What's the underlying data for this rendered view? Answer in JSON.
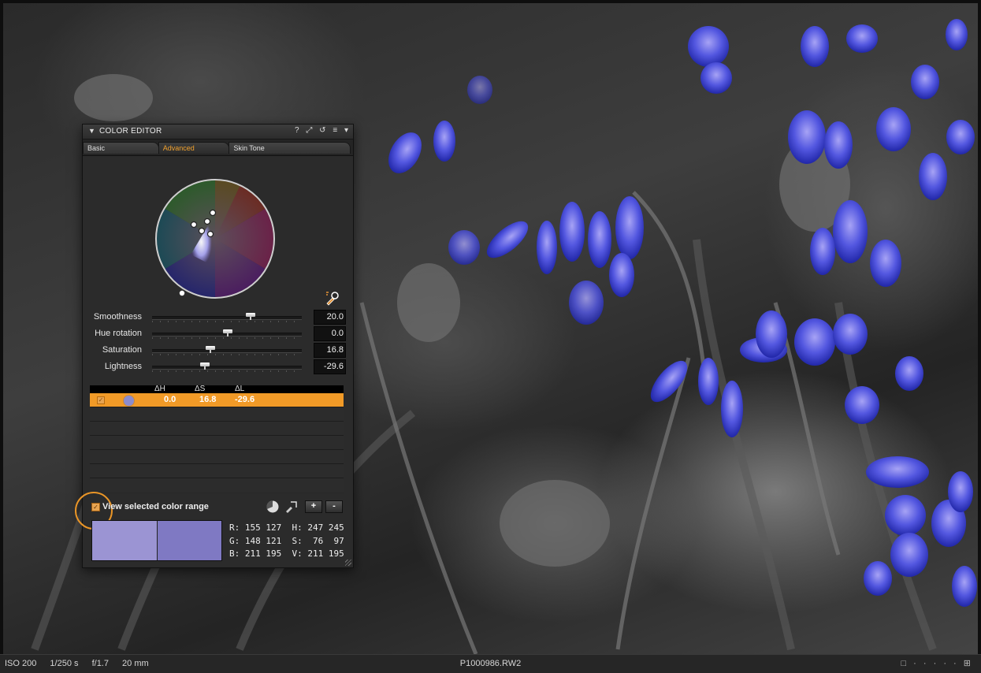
{
  "panel": {
    "title": "COLOR EDITOR",
    "tool_icons": [
      "help-icon",
      "pop-out-icon",
      "reset-icon",
      "menu-icon",
      "collapse-icon"
    ],
    "tool_glyphs": [
      "?",
      "⤢",
      "↺",
      "≡",
      "▾"
    ],
    "tabs": [
      {
        "label": "Basic",
        "active": false
      },
      {
        "label": "Advanced",
        "active": true
      },
      {
        "label": "Skin Tone",
        "active": false
      }
    ],
    "sliders": [
      {
        "label": "Smoothness",
        "value": "20.0",
        "position": 0.67
      },
      {
        "label": "Hue rotation",
        "value": "0.0",
        "position": 0.5
      },
      {
        "label": "Saturation",
        "value": "16.8",
        "position": 0.4
      },
      {
        "label": "Lightness",
        "value": "-29.6",
        "position": 0.36
      }
    ],
    "list": {
      "headers": {
        "dh": "ΔH",
        "ds": "ΔS",
        "dl": "ΔL"
      },
      "selected_row": {
        "dh": "0.0",
        "ds": "16.8",
        "dl": "-29.6",
        "swatch": "#8c8ccd"
      }
    },
    "view_range": {
      "label": "View selected color range",
      "checked": true
    },
    "plus": "+",
    "minus": "-",
    "swatches": [
      "#9b94d3",
      "#7f79c3"
    ],
    "readout": {
      "r": "R: 155 127",
      "g": "G: 148 121",
      "b": "B: 211 195",
      "h": "H: 247 245",
      "s": "S:  76  97",
      "v": "V: 211 195"
    }
  },
  "status": {
    "iso": "ISO 200",
    "shutter": "1/250 s",
    "aperture": "f/1.7",
    "focal": "20 mm",
    "filename": "P1000986.RW2",
    "view_tools": "□ · · · · · ⊞"
  },
  "colors": {
    "accent": "#f19a27",
    "flower": "#4b4fe0"
  }
}
